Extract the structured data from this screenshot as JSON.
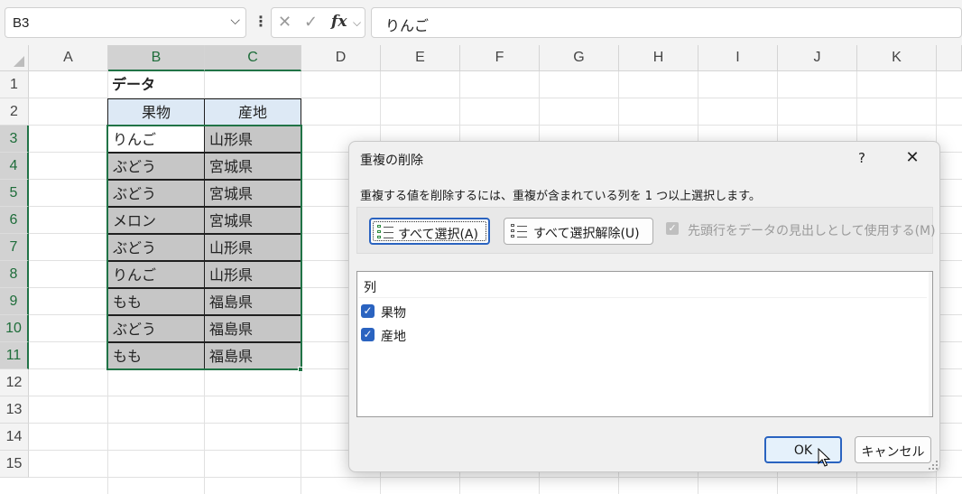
{
  "formula_bar": {
    "name_box": "B3",
    "cancel_glyph": "✕",
    "enter_glyph": "✓",
    "fx_glyph": "fx",
    "content": "りんご"
  },
  "grid": {
    "columns": [
      "A",
      "B",
      "C",
      "D",
      "E",
      "F",
      "G",
      "H",
      "I",
      "J",
      "K"
    ],
    "rows": [
      "1",
      "2",
      "3",
      "4",
      "5",
      "6",
      "7",
      "8",
      "9",
      "10",
      "11",
      "12",
      "13",
      "14",
      "15"
    ],
    "title": "データ",
    "headers": [
      "果物",
      "産地"
    ],
    "data": [
      [
        "りんご",
        "山形県"
      ],
      [
        "ぶどう",
        "宮城県"
      ],
      [
        "ぶどう",
        "宮城県"
      ],
      [
        "メロン",
        "宮城県"
      ],
      [
        "ぶどう",
        "山形県"
      ],
      [
        "りんご",
        "山形県"
      ],
      [
        "もも",
        "福島県"
      ],
      [
        "ぶどう",
        "福島県"
      ],
      [
        "もも",
        "福島県"
      ]
    ]
  },
  "dialog": {
    "title": "重複の削除",
    "help": "?",
    "close": "✕",
    "description": "重複する値を削除するには、重複が含まれている列を 1 つ以上選択します。",
    "select_all": "すべて選択(A)",
    "unselect_all": "すべて選択解除(U)",
    "header_option": "先頭行をデータの見出しとして使用する(M)",
    "columns_header": "列",
    "columns": [
      {
        "label": "果物",
        "checked": true
      },
      {
        "label": "産地",
        "checked": true
      }
    ],
    "ok": "OK",
    "cancel": "キャンセル"
  },
  "colors": {
    "excel_green": "#217346",
    "header_fill": "#dde9f5",
    "data_fill": "#c6c6c6",
    "accent_blue": "#2a63c0"
  }
}
